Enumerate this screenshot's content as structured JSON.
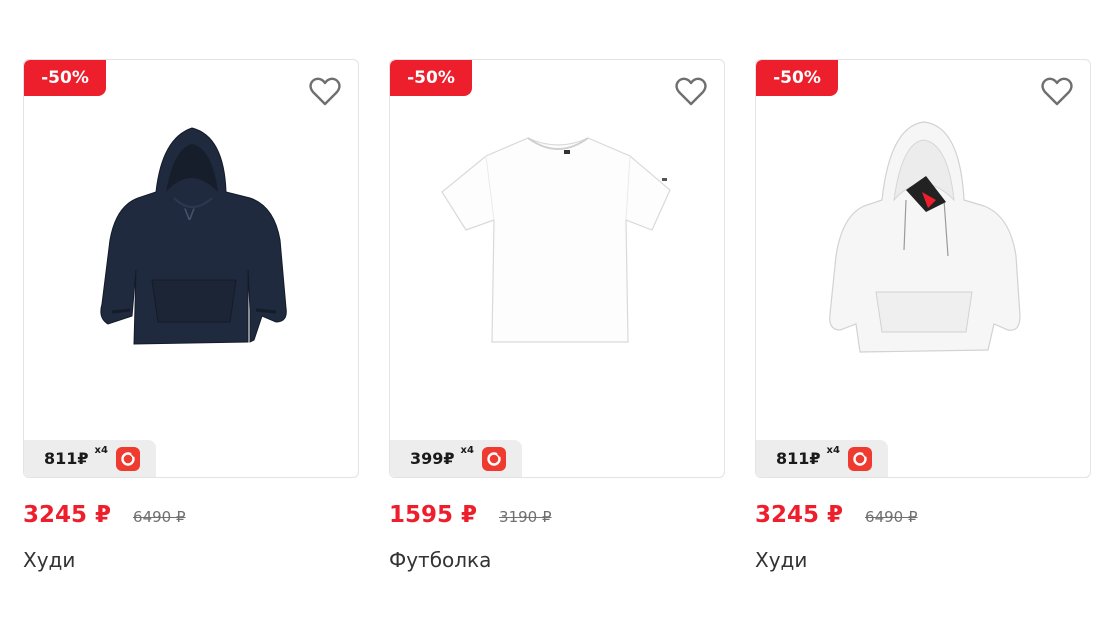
{
  "products": [
    {
      "discount": "-50%",
      "installment_price": "811₽",
      "installment_multiplier": "x4",
      "price": "3245 ₽",
      "old_price": "6490 ₽",
      "name": "Худи",
      "image": "navy-hoodie",
      "color": "#1f2a3e"
    },
    {
      "discount": "-50%",
      "installment_price": "399₽",
      "installment_multiplier": "x4",
      "price": "1595 ₽",
      "old_price": "3190 ₽",
      "name": "Футболка",
      "image": "white-tshirt",
      "color": "#ffffff"
    },
    {
      "discount": "-50%",
      "installment_price": "811₽",
      "installment_multiplier": "x4",
      "price": "3245 ₽",
      "old_price": "6490 ₽",
      "name": "Худи",
      "image": "white-hoodie",
      "color": "#f4f4f4"
    }
  ],
  "icons": {
    "favorite": "heart-outline-icon",
    "installment": "installment-service-logo"
  },
  "colors": {
    "accent": "#ee1f2d",
    "old_price": "#707070",
    "installment_bg": "#ededed"
  }
}
